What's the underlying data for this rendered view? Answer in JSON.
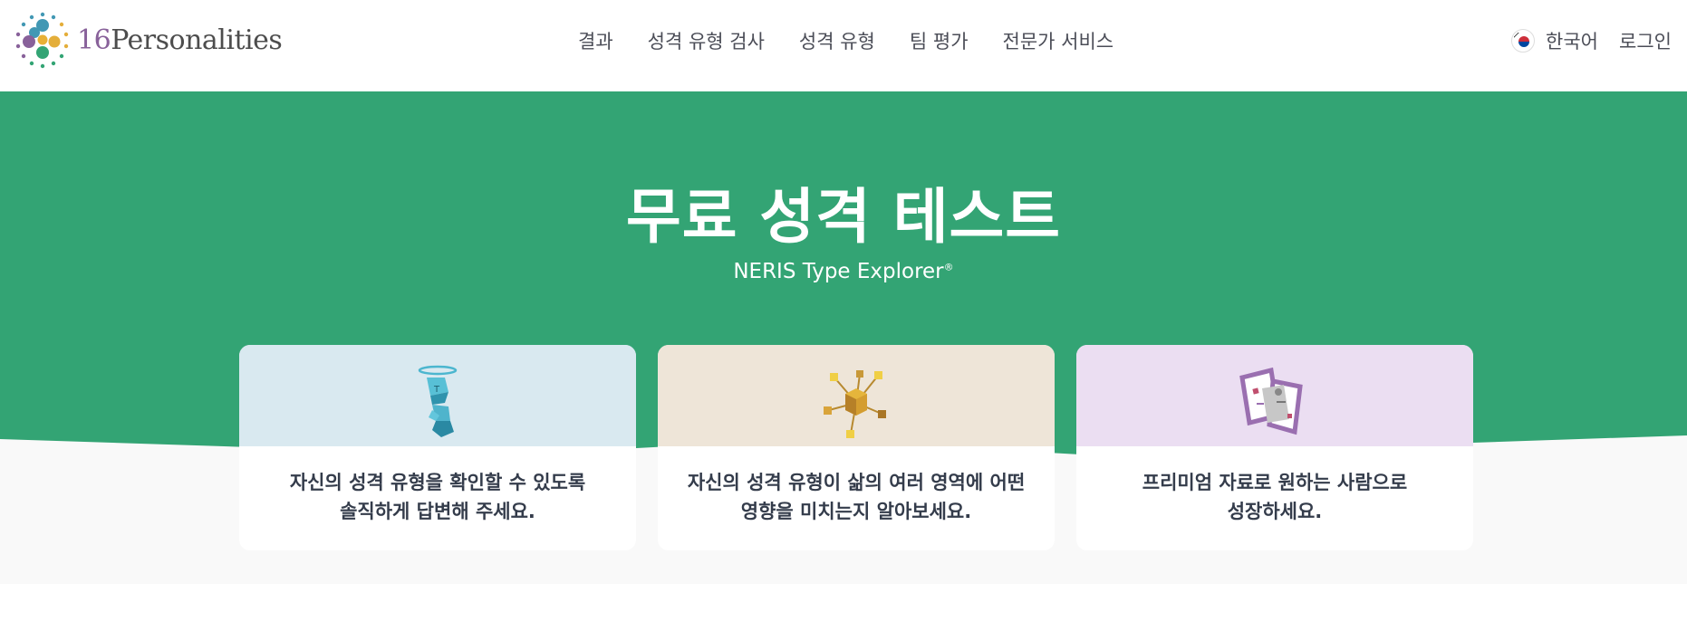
{
  "header": {
    "logo": {
      "number": "16",
      "word": "Personalities"
    },
    "nav": [
      {
        "label": "결과"
      },
      {
        "label": "성격 유형 검사"
      },
      {
        "label": "성격 유형"
      },
      {
        "label": "팀 평가"
      },
      {
        "label": "전문가 서비스"
      }
    ],
    "language": "한국어",
    "login": "로그인"
  },
  "hero": {
    "title": "무료 성격 테스트",
    "subtitle": "NERIS Type Explorer",
    "subtitle_mark": "®",
    "colors": {
      "green": "#33a474",
      "light": "#f9f9f9"
    }
  },
  "cards": [
    {
      "icon": "blue-cube-figure-icon",
      "line1": "자신의 성격 유형을 확인할 수 있도록",
      "line2": "솔직하게 답변해 주세요."
    },
    {
      "icon": "gold-cube-network-icon",
      "line1": "자신의 성격 유형이 삶의 여러 영역에 어떤",
      "line2": "영향을 미치는지 알아보세요."
    },
    {
      "icon": "purple-documents-icon",
      "line1": "프리미엄 자료로 원하는 사람으로",
      "line2": "성장하세요."
    }
  ]
}
